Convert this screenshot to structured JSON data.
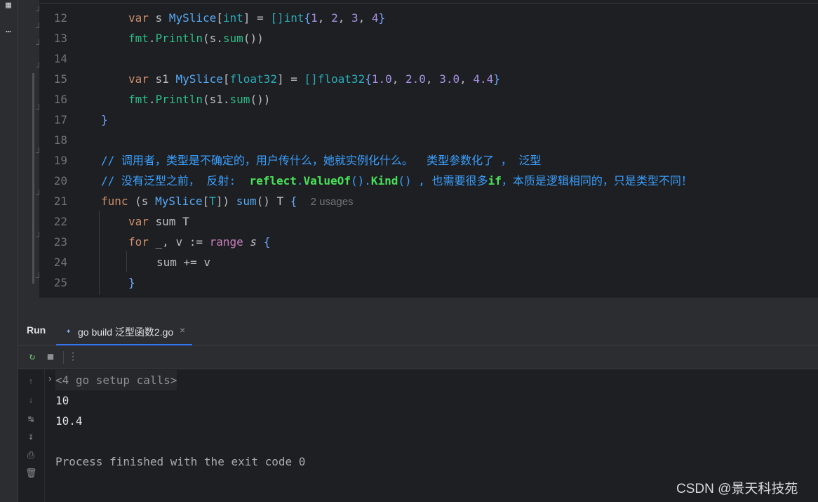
{
  "editor": {
    "line_numbers": [
      "12",
      "13",
      "14",
      "15",
      "16",
      "17",
      "18",
      "19",
      "20",
      "21",
      "22",
      "23",
      "24",
      "25"
    ],
    "lines": {
      "l12": {
        "kw": "var",
        "name": " s ",
        "type": "MySlice",
        "b1": "[",
        "targ": "int",
        "b2": "]",
        "eq": " = ",
        "slice": "[]",
        "elt": "int",
        "lb": "{",
        "n1": "1",
        "c1": ", ",
        "n2": "2",
        "c2": ", ",
        "n3": "3",
        "c3": ", ",
        "n4": "4",
        "rb": "}"
      },
      "l13": {
        "pkg": "fmt",
        "dot": ".",
        "fn": "Println",
        "lp": "(",
        "recv": "s",
        "dot2": ".",
        "call": "sum",
        "par": "()",
        "rp": ")"
      },
      "l15": {
        "kw": "var",
        "name": " s1 ",
        "type": "MySlice",
        "b1": "[",
        "targ": "float32",
        "b2": "]",
        "eq": " = ",
        "slice": "[]",
        "elt": "float32",
        "lb": "{",
        "n1": "1.0",
        "c1": ", ",
        "n2": "2.0",
        "c2": ", ",
        "n3": "3.0",
        "c3": ", ",
        "n4": "4.4",
        "rb": "}"
      },
      "l16": {
        "pkg": "fmt",
        "dot": ".",
        "fn": "Println",
        "lp": "(",
        "recv": "s1",
        "dot2": ".",
        "call": "sum",
        "par": "()",
        "rp": ")"
      },
      "l17": "}",
      "l19": "// 调用者，类型是不确定的，用户传什么，她就实例化什么。  类型参数化了 ， 泛型",
      "l20": {
        "a": "// 没有泛型之前， 反射:  ",
        "b": "reflect",
        "c": ".",
        "d": "ValueOf",
        "e": "().",
        "f": "Kind",
        "g": "() , 也需要很多",
        "h": "if",
        "i": "，本质是逻辑相同的，只是类型不同！"
      },
      "l21": {
        "kw": "func",
        "p1": " (s ",
        "type": "MySlice",
        "b1": "[",
        "tp": "T",
        "b2": "])",
        "sp": " ",
        "fn": "sum",
        "par": "()",
        "ret": " T ",
        "lb": "{",
        "hint": "2 usages"
      },
      "l22": {
        "kw": "var",
        "rest": " sum T"
      },
      "l23": {
        "kw": "for",
        "mid": " _, v := ",
        "range": "range",
        "s": " s ",
        "lb": "{"
      },
      "l24": "sum += v",
      "l25": "}"
    }
  },
  "run": {
    "title": "Run",
    "tab_label": "go build 泛型函数2.go",
    "tab_close": "×",
    "console": {
      "setup": "<4 go setup calls>",
      "out1": "10",
      "out2": "10.4",
      "exit": "Process finished with the exit code 0"
    }
  },
  "watermark": "CSDN @景天科技苑",
  "icons": [
    "structure-icon",
    "more-icon",
    "rerun-icon",
    "stop-icon",
    "options-icon",
    "go-file-icon",
    "up-arrow-icon",
    "down-arrow-icon",
    "soft-wrap-icon",
    "scroll-to-end-icon",
    "print-icon",
    "trash-icon",
    "fold-arrow-icon"
  ],
  "colors": {
    "keyword": "#cf8e6d",
    "type": "#56a8f5",
    "number": "#a591e4",
    "comment": "#3aa0ff",
    "accent": "#3574f0"
  }
}
